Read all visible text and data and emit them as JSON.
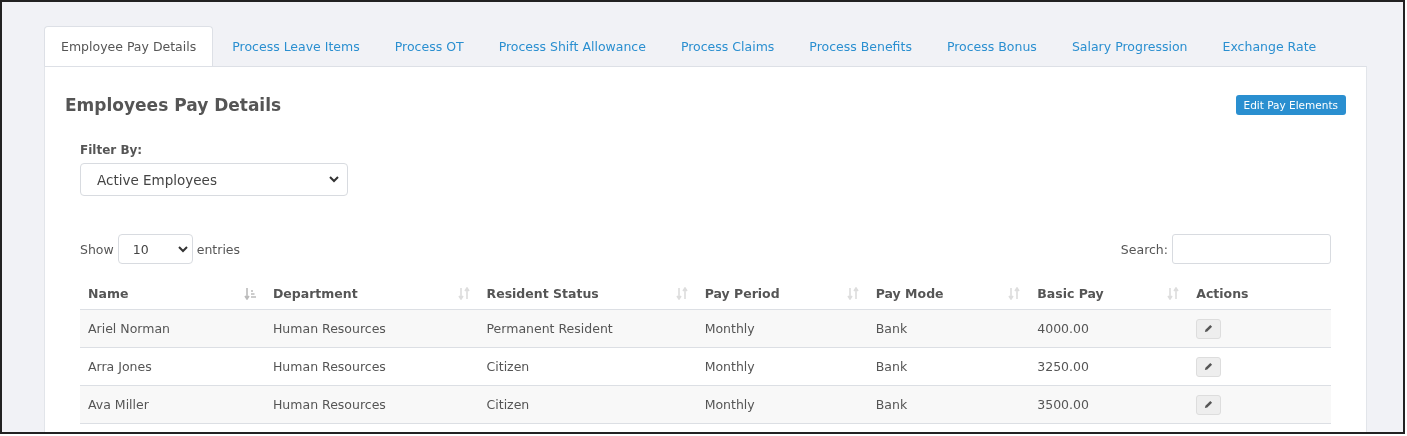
{
  "tabs": [
    {
      "label": "Employee Pay Details",
      "selected": true
    },
    {
      "label": "Process Leave Items",
      "selected": false
    },
    {
      "label": "Process OT",
      "selected": false
    },
    {
      "label": "Process Shift Allowance",
      "selected": false
    },
    {
      "label": "Process Claims",
      "selected": false
    },
    {
      "label": "Process Benefits",
      "selected": false
    },
    {
      "label": "Process Bonus",
      "selected": false
    },
    {
      "label": "Salary Progression",
      "selected": false
    },
    {
      "label": "Exchange Rate",
      "selected": false
    }
  ],
  "heading": "Employees Pay Details",
  "edit_button": "Edit Pay Elements",
  "filter": {
    "label": "Filter By:",
    "value": "Active Employees"
  },
  "length": {
    "prefix": "Show",
    "value": "10",
    "suffix": "entries"
  },
  "search": {
    "label": "Search:"
  },
  "table": {
    "columns": [
      {
        "label": "Name",
        "kind": "sortable",
        "sorted": true
      },
      {
        "label": "Department",
        "kind": "sortable",
        "sorted": false
      },
      {
        "label": "Resident Status",
        "kind": "sortable",
        "sorted": false
      },
      {
        "label": "Pay Period",
        "kind": "sortable",
        "sorted": false
      },
      {
        "label": "Pay Mode",
        "kind": "sortable",
        "sorted": false
      },
      {
        "label": "Basic Pay",
        "kind": "sortable",
        "sorted": false
      },
      {
        "label": "Actions",
        "kind": "plain"
      }
    ],
    "rows": [
      {
        "cells": [
          "Ariel Norman",
          "Human Resources",
          "Permanent Resident",
          "Monthly",
          "Bank",
          "4000.00"
        ]
      },
      {
        "cells": [
          "Arra Jones",
          "Human Resources",
          "Citizen",
          "Monthly",
          "Bank",
          "3250.00"
        ]
      },
      {
        "cells": [
          "Ava Miller",
          "Human Resources",
          "Citizen",
          "Monthly",
          "Bank",
          "3500.00"
        ]
      }
    ]
  }
}
